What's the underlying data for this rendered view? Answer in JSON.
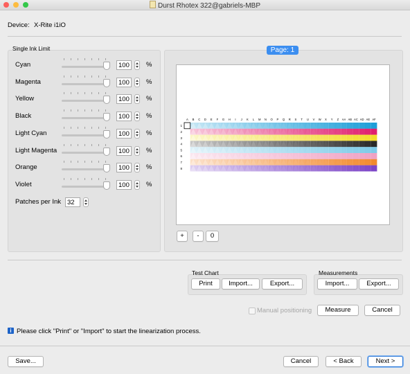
{
  "window": {
    "title": "Durst Rhotex 322@gabriels-MBP",
    "traffic_lights": {
      "close": "#fc605c",
      "minimize": "#fdbc40",
      "zoom": "#34c84a"
    }
  },
  "device": {
    "label": "Device:",
    "value": "X-Rite i1iO"
  },
  "ink_limit": {
    "group_title": "Single Ink Limit",
    "unit": "%",
    "inks": [
      {
        "name": "Cyan",
        "value": "100"
      },
      {
        "name": "Magenta",
        "value": "100"
      },
      {
        "name": "Yellow",
        "value": "100"
      },
      {
        "name": "Black",
        "value": "100"
      },
      {
        "name": "Light Cyan",
        "value": "100"
      },
      {
        "name": "Light Magenta",
        "value": "100"
      },
      {
        "name": "Orange",
        "value": "100"
      },
      {
        "name": "Violet",
        "value": "100"
      }
    ],
    "patches_label": "Patches per Ink",
    "patches_value": "32"
  },
  "preview": {
    "page_label": "Page: 1",
    "zoom_in_label": "+",
    "zoom_out_label": "-",
    "zoom_reset_label": "0",
    "columns": [
      "A",
      "B",
      "C",
      "D",
      "E",
      "F",
      "G",
      "H",
      "I",
      "J",
      "K",
      "L",
      "M",
      "N",
      "O",
      "P",
      "Q",
      "R",
      "S",
      "T",
      "U",
      "V",
      "W",
      "X",
      "Y",
      "Z",
      "AA",
      "AB",
      "AC",
      "AD",
      "AE",
      "AF"
    ],
    "rows": [
      "1",
      "2",
      "3",
      "4",
      "5",
      "6",
      "7",
      "8"
    ],
    "row_colors": [
      "#1e9fd8",
      "#e0206e",
      "#f2dd2c",
      "#2a2a2a",
      "#7fcbe8",
      "#f0a2c4",
      "#f28a2e",
      "#7d46c8"
    ]
  },
  "test_chart": {
    "title": "Test Chart",
    "print_label": "Print",
    "import_label": "Import...",
    "export_label": "Export..."
  },
  "measurements": {
    "title": "Measurements",
    "import_label": "Import...",
    "export_label": "Export..."
  },
  "manual_positioning_label": "Manual positioning",
  "manual_positioning_checked": false,
  "measure_label": "Measure",
  "cancel_label": "Cancel",
  "info_message": "Please click \"Print\" or \"Import\" to start the linearization process.",
  "footer": {
    "save_label": "Save...",
    "cancel_label": "Cancel",
    "back_label": "< Back",
    "next_label": "Next >"
  }
}
